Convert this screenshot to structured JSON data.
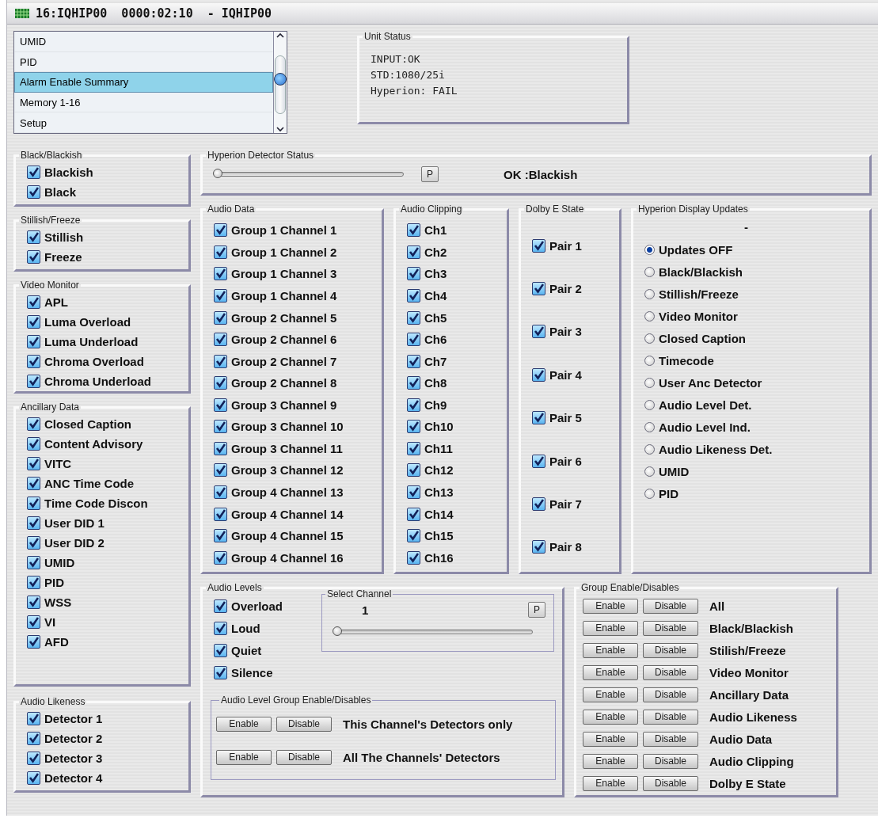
{
  "window": {
    "title": "16:IQHIP00  0000:02:10  - IQHIP00"
  },
  "menu_list": {
    "items": [
      {
        "label": "UMID",
        "selected": false
      },
      {
        "label": "PID",
        "selected": false
      },
      {
        "label": "Alarm Enable Summary",
        "selected": true
      },
      {
        "label": "Memory 1-16",
        "selected": false
      },
      {
        "label": "Setup",
        "selected": false
      }
    ]
  },
  "unit_status": {
    "title": "Unit Status",
    "lines": [
      "INPUT:OK",
      "STD:1080/25i",
      "Hyperion: FAIL"
    ]
  },
  "left_groups": [
    {
      "title": "Black/Blackish",
      "items": [
        {
          "label": "Blackish",
          "checked": true
        },
        {
          "label": "Black",
          "checked": true
        }
      ]
    },
    {
      "title": "Stillish/Freeze",
      "items": [
        {
          "label": "Stillish",
          "checked": true
        },
        {
          "label": "Freeze",
          "checked": true
        }
      ]
    },
    {
      "title": "Video Monitor",
      "items": [
        {
          "label": "APL",
          "checked": true
        },
        {
          "label": "Luma Overload",
          "checked": true
        },
        {
          "label": "Luma Underload",
          "checked": true
        },
        {
          "label": "Chroma Overload",
          "checked": true
        },
        {
          "label": "Chroma Underload",
          "checked": true
        }
      ]
    },
    {
      "title": "Ancillary Data",
      "items": [
        {
          "label": "Closed Caption",
          "checked": true
        },
        {
          "label": "Content Advisory",
          "checked": true
        },
        {
          "label": "VITC",
          "checked": true
        },
        {
          "label": "ANC Time Code",
          "checked": true
        },
        {
          "label": "Time Code Discon",
          "checked": true
        },
        {
          "label": "User DID 1",
          "checked": true
        },
        {
          "label": "User DID 2",
          "checked": true
        },
        {
          "label": "UMID",
          "checked": true
        },
        {
          "label": "PID",
          "checked": true
        },
        {
          "label": "WSS",
          "checked": true
        },
        {
          "label": "VI",
          "checked": true
        },
        {
          "label": "AFD",
          "checked": true
        }
      ]
    },
    {
      "title": "Audio Likeness",
      "items": [
        {
          "label": "Detector 1",
          "checked": true
        },
        {
          "label": "Detector 2",
          "checked": true
        },
        {
          "label": "Detector 3",
          "checked": true
        },
        {
          "label": "Detector 4",
          "checked": true
        }
      ]
    }
  ],
  "hyperion_detector_status": {
    "title": "Hyperion Detector Status",
    "slider": {
      "level": 0
    },
    "button": "P",
    "status": "OK :Blackish"
  },
  "audio_data": {
    "title": "Audio Data",
    "items": [
      {
        "label": "Group 1 Channel 1",
        "checked": true
      },
      {
        "label": "Group 1 Channel 2",
        "checked": true
      },
      {
        "label": "Group 1 Channel 3",
        "checked": true
      },
      {
        "label": "Group 1 Channel 4",
        "checked": true
      },
      {
        "label": "Group 2 Channel 5",
        "checked": true
      },
      {
        "label": "Group 2 Channel 6",
        "checked": true
      },
      {
        "label": "Group 2 Channel 7",
        "checked": true
      },
      {
        "label": "Group 2 Channel 8",
        "checked": true
      },
      {
        "label": "Group 3 Channel 9",
        "checked": true
      },
      {
        "label": "Group 3 Channel 10",
        "checked": true
      },
      {
        "label": "Group 3 Channel 11",
        "checked": true
      },
      {
        "label": "Group 3 Channel 12",
        "checked": true
      },
      {
        "label": "Group 4 Channel 13",
        "checked": true
      },
      {
        "label": "Group 4 Channel 14",
        "checked": true
      },
      {
        "label": "Group 4 Channel 15",
        "checked": true
      },
      {
        "label": "Group 4 Channel 16",
        "checked": true
      }
    ]
  },
  "audio_clipping": {
    "title": "Audio Clipping",
    "items": [
      {
        "label": "Ch1",
        "checked": true
      },
      {
        "label": "Ch2",
        "checked": true
      },
      {
        "label": "Ch3",
        "checked": true
      },
      {
        "label": "Ch4",
        "checked": true
      },
      {
        "label": "Ch5",
        "checked": true
      },
      {
        "label": "Ch6",
        "checked": true
      },
      {
        "label": "Ch7",
        "checked": true
      },
      {
        "label": "Ch8",
        "checked": true
      },
      {
        "label": "Ch9",
        "checked": true
      },
      {
        "label": "Ch10",
        "checked": true
      },
      {
        "label": "Ch11",
        "checked": true
      },
      {
        "label": "Ch12",
        "checked": true
      },
      {
        "label": "Ch13",
        "checked": true
      },
      {
        "label": "Ch14",
        "checked": true
      },
      {
        "label": "Ch15",
        "checked": true
      },
      {
        "label": "Ch16",
        "checked": true
      }
    ]
  },
  "dolby_e_state": {
    "title": "Dolby E State",
    "items": [
      {
        "label": "Pair 1",
        "checked": true
      },
      {
        "label": "Pair 2",
        "checked": true
      },
      {
        "label": "Pair 3",
        "checked": true
      },
      {
        "label": "Pair 4",
        "checked": true
      },
      {
        "label": "Pair 5",
        "checked": true
      },
      {
        "label": "Pair 6",
        "checked": true
      },
      {
        "label": "Pair 7",
        "checked": true
      },
      {
        "label": "Pair 8",
        "checked": true
      }
    ]
  },
  "hyperion_display_updates": {
    "title": "Hyperion Display Updates",
    "value": "-",
    "options": [
      {
        "label": "Updates OFF",
        "selected": true
      },
      {
        "label": "Black/Blackish",
        "selected": false
      },
      {
        "label": "Stillish/Freeze",
        "selected": false
      },
      {
        "label": "Video Monitor",
        "selected": false
      },
      {
        "label": "Closed Caption",
        "selected": false
      },
      {
        "label": "Timecode",
        "selected": false
      },
      {
        "label": "User Anc Detector",
        "selected": false
      },
      {
        "label": "Audio Level Det.",
        "selected": false
      },
      {
        "label": "Audio Level Ind.",
        "selected": false
      },
      {
        "label": "Audio Likeness Det.",
        "selected": false
      },
      {
        "label": "UMID",
        "selected": false
      },
      {
        "label": "PID",
        "selected": false
      }
    ]
  },
  "audio_levels": {
    "title": "Audio Levels",
    "items": [
      {
        "label": "Overload",
        "checked": true
      },
      {
        "label": "Loud",
        "checked": true
      },
      {
        "label": "Quiet",
        "checked": true
      },
      {
        "label": "Silence",
        "checked": true
      }
    ],
    "select_channel": {
      "title": "Select Channel",
      "value": "1",
      "button": "P",
      "slider": {
        "level": 0
      }
    },
    "group_enable": {
      "title": "Audio Level Group Enable/Disables",
      "rows": [
        {
          "enable": "Enable",
          "disable": "Disable",
          "label": "This Channel's Detectors only"
        },
        {
          "enable": "Enable",
          "disable": "Disable",
          "label": "All The Channels' Detectors"
        }
      ]
    }
  },
  "group_enable_disables": {
    "title": "Group Enable/Disables",
    "rows": [
      {
        "enable": "Enable",
        "disable": "Disable",
        "label": "All"
      },
      {
        "enable": "Enable",
        "disable": "Disable",
        "label": "Black/Blackish"
      },
      {
        "enable": "Enable",
        "disable": "Disable",
        "label": "Stilish/Freeze"
      },
      {
        "enable": "Enable",
        "disable": "Disable",
        "label": "Video Monitor"
      },
      {
        "enable": "Enable",
        "disable": "Disable",
        "label": "Ancillary Data"
      },
      {
        "enable": "Enable",
        "disable": "Disable",
        "label": "Audio Likeness"
      },
      {
        "enable": "Enable",
        "disable": "Disable",
        "label": "Audio Data"
      },
      {
        "enable": "Enable",
        "disable": "Disable",
        "label": "Audio Clipping"
      },
      {
        "enable": "Enable",
        "disable": "Disable",
        "label": "Dolby E State"
      }
    ]
  }
}
